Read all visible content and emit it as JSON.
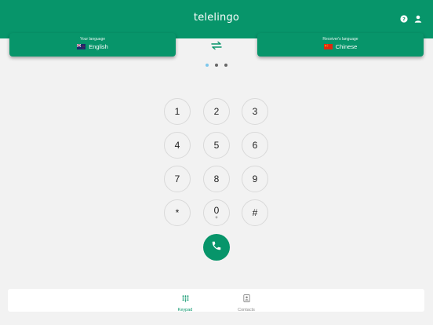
{
  "header": {
    "title": "telelingo",
    "help_icon": "help-circle-icon",
    "account_icon": "person-icon"
  },
  "languages": {
    "source": {
      "caption": "Your language",
      "value": "English",
      "flag": "new-zealand-flag-icon"
    },
    "target": {
      "caption": "Receiver's language",
      "value": "Chinese",
      "flag": "china-flag-icon"
    },
    "swap_icon": "swap-arrows-icon"
  },
  "pager": {
    "count": 3,
    "active_index": 0
  },
  "keypad": {
    "keys": [
      {
        "digit": "1",
        "sub": ""
      },
      {
        "digit": "2",
        "sub": ""
      },
      {
        "digit": "3",
        "sub": ""
      },
      {
        "digit": "4",
        "sub": ""
      },
      {
        "digit": "5",
        "sub": ""
      },
      {
        "digit": "6",
        "sub": ""
      },
      {
        "digit": "7",
        "sub": ""
      },
      {
        "digit": "8",
        "sub": ""
      },
      {
        "digit": "9",
        "sub": ""
      },
      {
        "digit": "*",
        "sub": ""
      },
      {
        "digit": "0",
        "sub": "+"
      },
      {
        "digit": "#",
        "sub": ""
      }
    ],
    "call_icon": "phone-icon"
  },
  "bottom_nav": {
    "items": [
      {
        "label": "Keypad",
        "icon": "keypad-grid-icon",
        "active": true
      },
      {
        "label": "Contacts",
        "icon": "contacts-book-icon",
        "active": false
      }
    ]
  },
  "colors": {
    "primary": "#07956a",
    "background": "#f2f2f2",
    "active_dot": "#7cc7ec",
    "inactive_nav": "#888888"
  }
}
